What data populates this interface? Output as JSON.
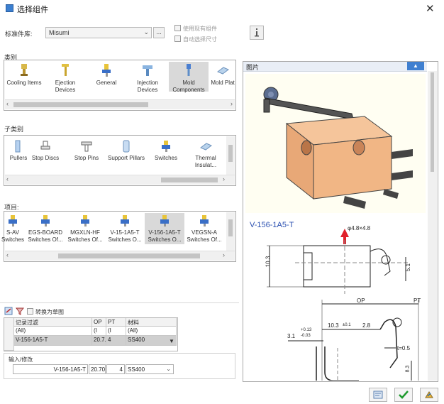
{
  "window": {
    "title": "选择组件"
  },
  "library": {
    "label": "标准件库:",
    "value": "Misumi",
    "browse_label": "...",
    "use_existing_label": "使用现有组件",
    "auto_size_label": "自动选择尺寸"
  },
  "category": {
    "label": "类别",
    "items": [
      {
        "label": "Cooling Items",
        "icon": "cooling-icon"
      },
      {
        "label": "Ejection Devices",
        "icon": "ejection-icon"
      },
      {
        "label": "General",
        "icon": "general-icon"
      },
      {
        "label": "Injection Devices",
        "icon": "injection-icon"
      },
      {
        "label": "Mold Components",
        "icon": "mold-components-icon"
      },
      {
        "label": "Mold Plat",
        "icon": "mold-plate-icon"
      }
    ]
  },
  "subcategory": {
    "label": "子类别",
    "items": [
      {
        "label": "Pullers"
      },
      {
        "label": "Stop Discs"
      },
      {
        "label": "Stop Pins"
      },
      {
        "label": "Support Pillars"
      },
      {
        "label": "Switches"
      },
      {
        "label": "Thermal Insulat..."
      }
    ]
  },
  "items": {
    "label": "项目:",
    "list": [
      {
        "label": "S-AV Switches"
      },
      {
        "label": "EGS-BOARD Switches Of..."
      },
      {
        "label": "MGXLN-HF Switches Of..."
      },
      {
        "label": "V-15-1A5-T Switches O..."
      },
      {
        "label": "V-156-1A5-T Switches O..."
      },
      {
        "label": "VEGSN-A Switches Of..."
      }
    ]
  },
  "grid_toolbar": {
    "convert_label": "转换为草图"
  },
  "grid": {
    "headers": [
      "记录过滤",
      "OP",
      "PT",
      "材料"
    ],
    "filter_row": [
      "(All)",
      "(I",
      "(I",
      "(All)"
    ],
    "selected_row": [
      "V-156-1A5-T",
      "20.7...",
      "4",
      "SS400"
    ]
  },
  "edit": {
    "label": "输入/修改",
    "name": "V-156-1A5-T",
    "op": "20.70",
    "pt": "4",
    "material": "SS400"
  },
  "preview": {
    "label": "图片",
    "part_name": "V-156-1A5-T",
    "dims": {
      "hole": "φ4.8×4.8",
      "height": "10.3",
      "side": "5.1",
      "op": "OP",
      "pt": "PT",
      "len": "10.3",
      "tol1": "±0.1",
      "d2": "2.8",
      "d3": "3.1",
      "tol2": "+0.13",
      "tol3": "-0.03",
      "thick": "t=0.5",
      "v8": "8.3"
    }
  }
}
